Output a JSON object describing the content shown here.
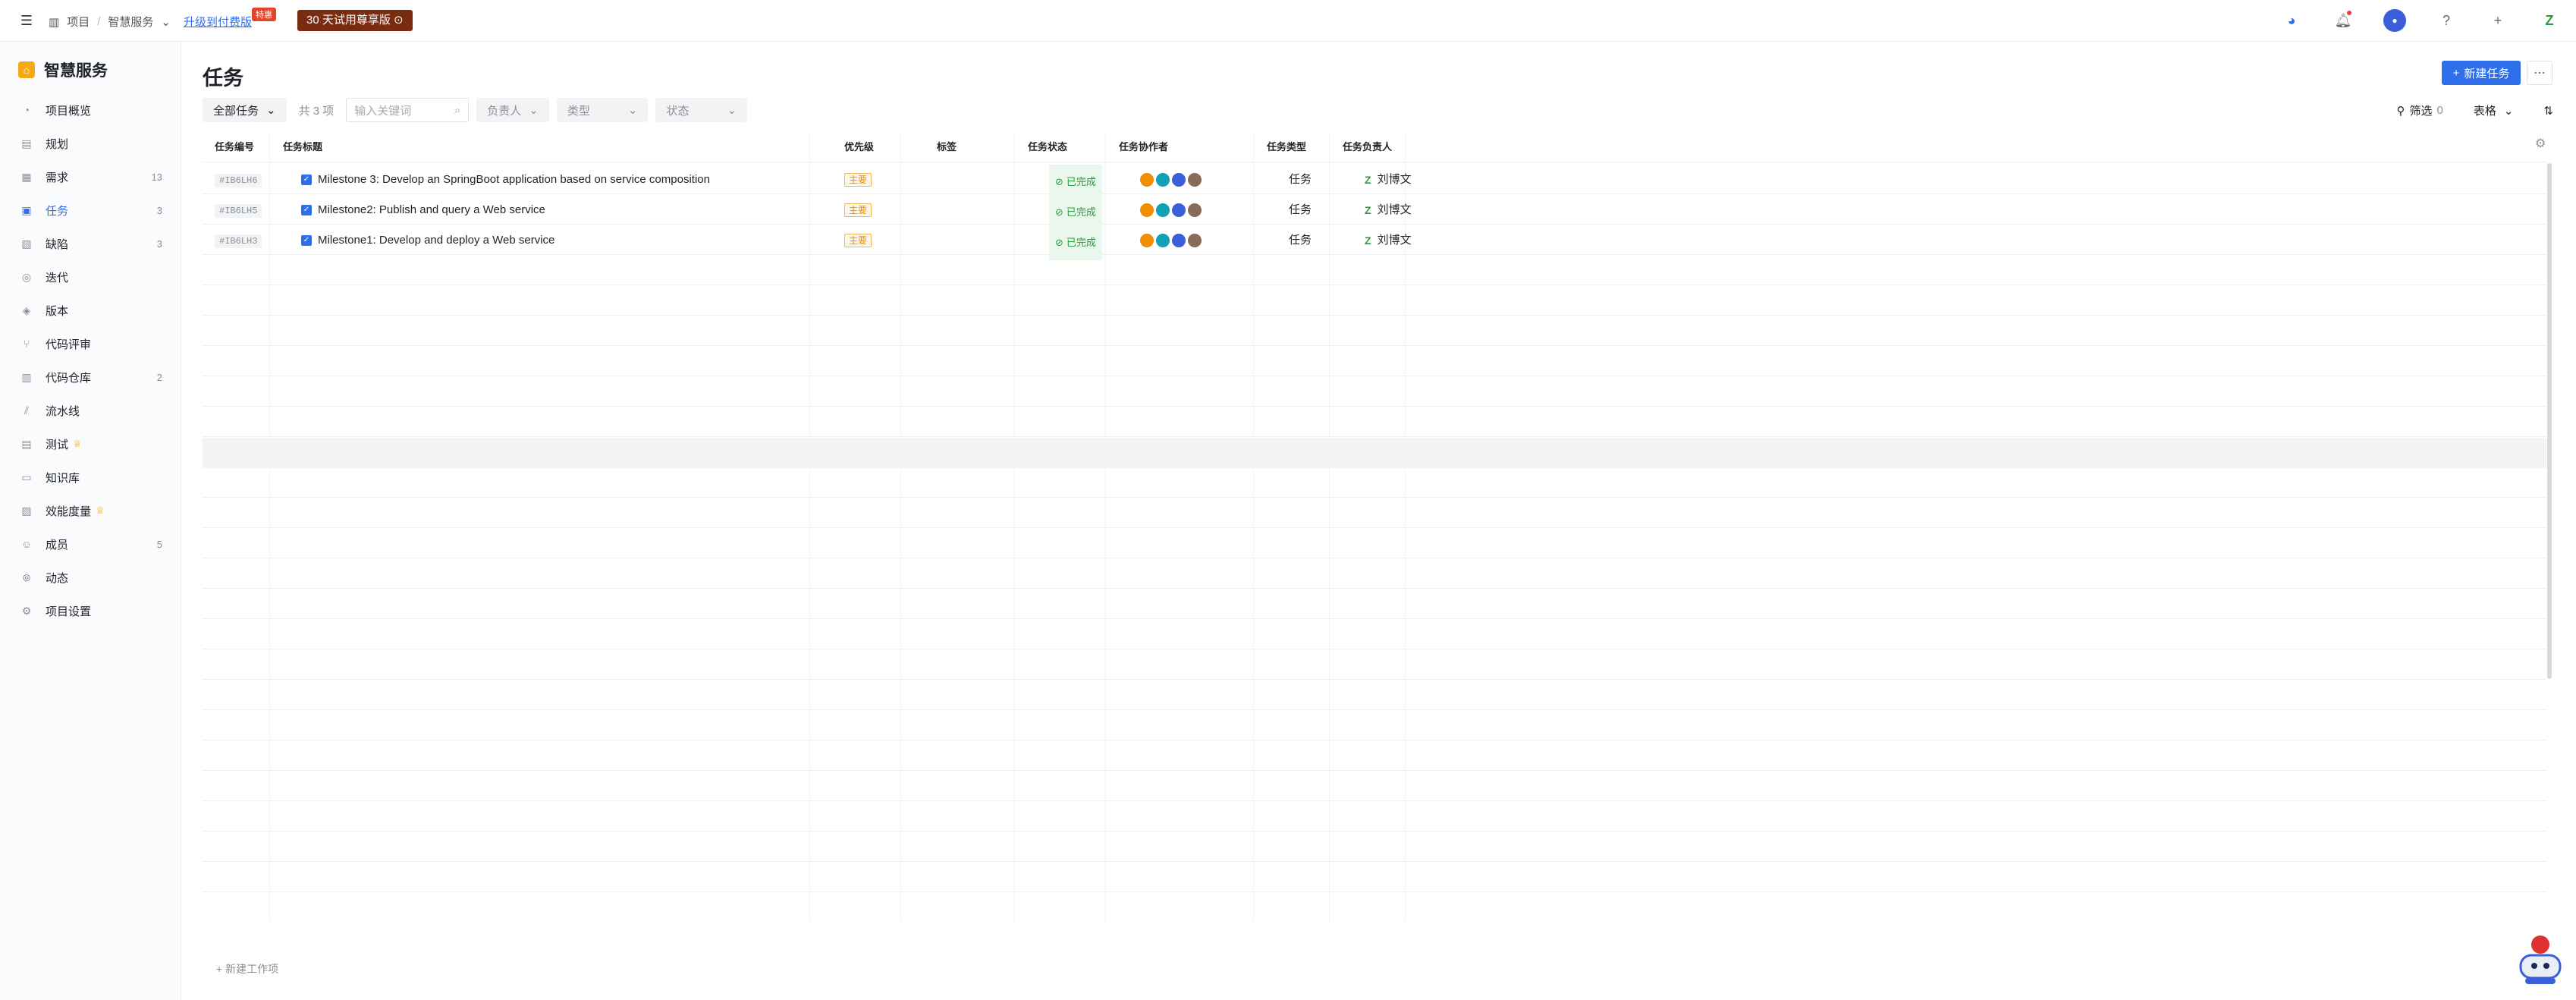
{
  "topbar": {
    "breadcrumb": [
      "项目",
      "智慧服务"
    ],
    "upgrade_link": "升级到付费版",
    "special_badge": "特惠",
    "trial_button": "30 天试用尊享版 ⊙"
  },
  "sidebar": {
    "project_name": "智慧服务",
    "items": [
      {
        "label": "项目概览",
        "icon": "overview-icon",
        "count": ""
      },
      {
        "label": "规划",
        "icon": "plan-icon",
        "count": ""
      },
      {
        "label": "需求",
        "icon": "requirement-icon",
        "count": "13"
      },
      {
        "label": "任务",
        "icon": "task-icon",
        "count": "3"
      },
      {
        "label": "缺陷",
        "icon": "bug-icon",
        "count": "3"
      },
      {
        "label": "迭代",
        "icon": "iteration-icon",
        "count": ""
      },
      {
        "label": "版本",
        "icon": "version-icon",
        "count": ""
      },
      {
        "label": "代码评审",
        "icon": "code-review-icon",
        "count": ""
      },
      {
        "label": "代码仓库",
        "icon": "repo-icon",
        "count": "2"
      },
      {
        "label": "流水线",
        "icon": "pipeline-icon",
        "count": ""
      },
      {
        "label": "测试",
        "icon": "test-icon",
        "count": ""
      },
      {
        "label": "知识库",
        "icon": "wiki-icon",
        "count": ""
      },
      {
        "label": "效能度量",
        "icon": "metrics-icon",
        "count": ""
      },
      {
        "label": "成员",
        "icon": "members-icon",
        "count": "5"
      },
      {
        "label": "动态",
        "icon": "activity-icon",
        "count": ""
      },
      {
        "label": "项目设置",
        "icon": "settings-icon",
        "count": ""
      }
    ]
  },
  "main": {
    "title": "任务",
    "new_button": "新建任务",
    "filters": {
      "all_tasks": "全部任务",
      "count": "共 3 项",
      "search_placeholder": "输入关键词",
      "assignee": "负责人",
      "type": "类型",
      "status": "状态"
    },
    "tools": {
      "filter": "筛选",
      "filter_count": "0",
      "view": "表格"
    },
    "columns": [
      "任务编号",
      "任务标题",
      "优先级",
      "标签",
      "任务状态",
      "任务协作者",
      "任务类型",
      "任务负责人"
    ],
    "rows": [
      {
        "id": "#IB6LH6",
        "title": "Milestone 3: Develop an SpringBoot application based on service composition",
        "priority": "主要",
        "status": "已完成",
        "type": "任务",
        "owner": "刘博文"
      },
      {
        "id": "#IB6LH5",
        "title": "Milestone2: Publish and query a Web service",
        "priority": "主要",
        "status": "已完成",
        "type": "任务",
        "owner": "刘博文"
      },
      {
        "id": "#IB6LH3",
        "title": "Milestone1: Develop and deploy a Web service",
        "priority": "主要",
        "status": "已完成",
        "type": "任务",
        "owner": "刘博文"
      }
    ],
    "new_item": "+ 新建工作项"
  },
  "colors": {
    "accent": "#2f6fec",
    "success": "#2b9a3e",
    "warning": "#f08c00"
  }
}
